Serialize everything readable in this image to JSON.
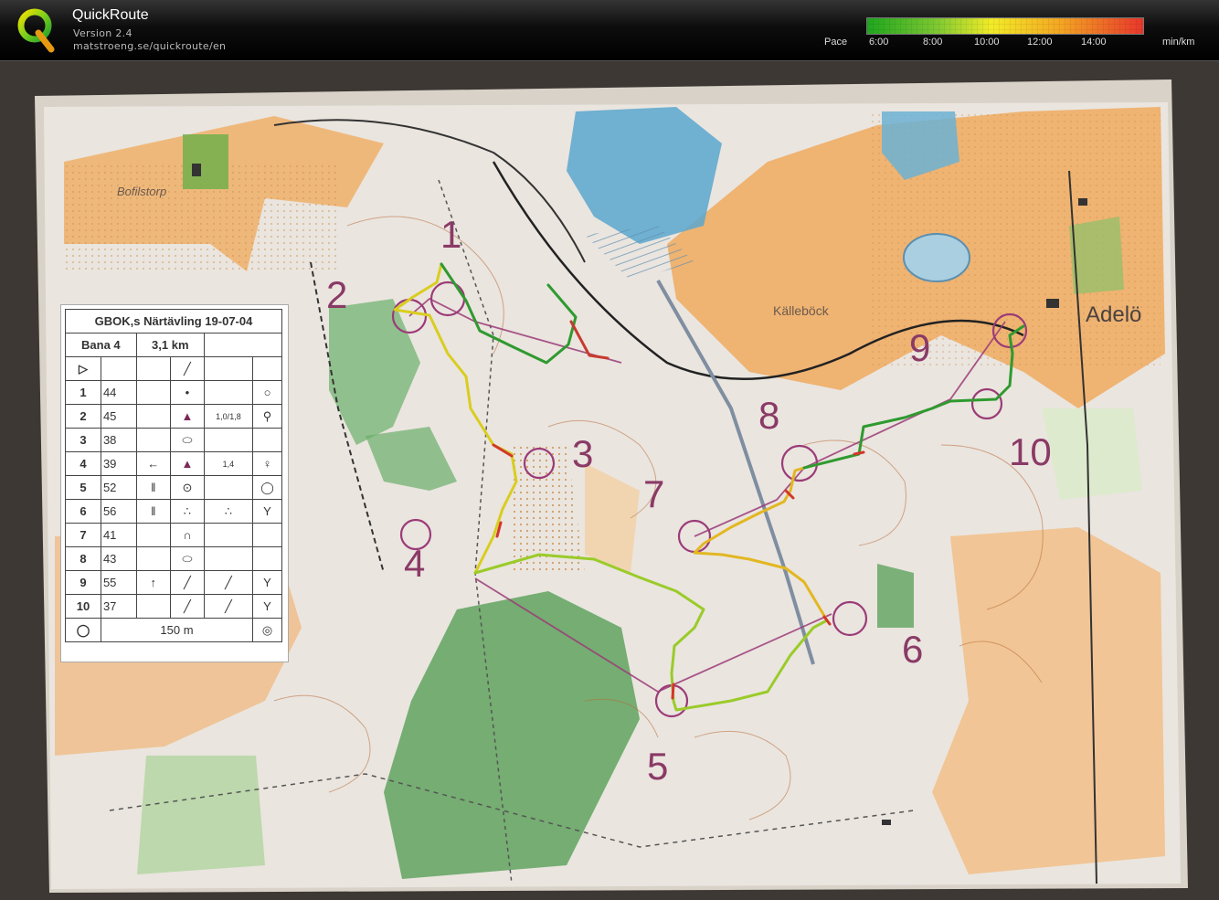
{
  "app": {
    "name": "QuickRoute",
    "version": "Version 2.4",
    "url": "matstroeng.se/quickroute/en"
  },
  "pace": {
    "label": "Pace",
    "unit": "min/km",
    "ticks": [
      "6:00",
      "8:00",
      "10:00",
      "12:00",
      "14:00"
    ]
  },
  "map": {
    "legend": {
      "title": "GBOK,s Närtävling 19-07-04",
      "course": "Bana 4",
      "length": "3,1 km",
      "controls": [
        {
          "n": "1",
          "code": "44"
        },
        {
          "n": "2",
          "code": "45"
        },
        {
          "n": "3",
          "code": "38"
        },
        {
          "n": "4",
          "code": "39"
        },
        {
          "n": "5",
          "code": "52"
        },
        {
          "n": "6",
          "code": "56"
        },
        {
          "n": "7",
          "code": "41"
        },
        {
          "n": "8",
          "code": "43"
        },
        {
          "n": "9",
          "code": "55"
        },
        {
          "n": "10",
          "code": "37"
        }
      ],
      "finish": "150 m",
      "extra": [
        "1,0",
        "1,8",
        "1,4"
      ]
    },
    "control_labels": [
      "1",
      "2",
      "3",
      "4",
      "5",
      "6",
      "7",
      "8",
      "9",
      "10"
    ],
    "place_names": [
      "Bofilstorp",
      "Källeböck",
      "Adelö"
    ]
  }
}
